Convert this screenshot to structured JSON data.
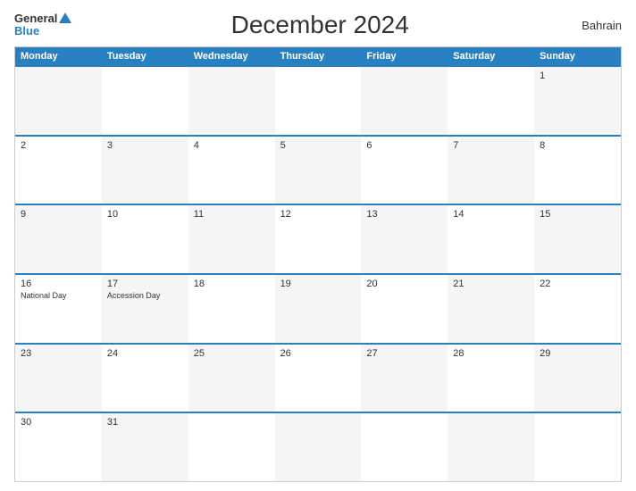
{
  "header": {
    "logo_general": "General",
    "logo_blue": "Blue",
    "title": "December 2024",
    "country": "Bahrain"
  },
  "calendar": {
    "weekdays": [
      "Monday",
      "Tuesday",
      "Wednesday",
      "Thursday",
      "Friday",
      "Saturday",
      "Sunday"
    ],
    "rows": [
      [
        {
          "day": "",
          "event": ""
        },
        {
          "day": "",
          "event": ""
        },
        {
          "day": "",
          "event": ""
        },
        {
          "day": "",
          "event": ""
        },
        {
          "day": "",
          "event": ""
        },
        {
          "day": "",
          "event": ""
        },
        {
          "day": "1",
          "event": ""
        }
      ],
      [
        {
          "day": "2",
          "event": ""
        },
        {
          "day": "3",
          "event": ""
        },
        {
          "day": "4",
          "event": ""
        },
        {
          "day": "5",
          "event": ""
        },
        {
          "day": "6",
          "event": ""
        },
        {
          "day": "7",
          "event": ""
        },
        {
          "day": "8",
          "event": ""
        }
      ],
      [
        {
          "day": "9",
          "event": ""
        },
        {
          "day": "10",
          "event": ""
        },
        {
          "day": "11",
          "event": ""
        },
        {
          "day": "12",
          "event": ""
        },
        {
          "day": "13",
          "event": ""
        },
        {
          "day": "14",
          "event": ""
        },
        {
          "day": "15",
          "event": ""
        }
      ],
      [
        {
          "day": "16",
          "event": "National Day"
        },
        {
          "day": "17",
          "event": "Accession Day"
        },
        {
          "day": "18",
          "event": ""
        },
        {
          "day": "19",
          "event": ""
        },
        {
          "day": "20",
          "event": ""
        },
        {
          "day": "21",
          "event": ""
        },
        {
          "day": "22",
          "event": ""
        }
      ],
      [
        {
          "day": "23",
          "event": ""
        },
        {
          "day": "24",
          "event": ""
        },
        {
          "day": "25",
          "event": ""
        },
        {
          "day": "26",
          "event": ""
        },
        {
          "day": "27",
          "event": ""
        },
        {
          "day": "28",
          "event": ""
        },
        {
          "day": "29",
          "event": ""
        }
      ],
      [
        {
          "day": "30",
          "event": ""
        },
        {
          "day": "31",
          "event": ""
        },
        {
          "day": "",
          "event": ""
        },
        {
          "day": "",
          "event": ""
        },
        {
          "day": "",
          "event": ""
        },
        {
          "day": "",
          "event": ""
        },
        {
          "day": "",
          "event": ""
        }
      ]
    ]
  }
}
